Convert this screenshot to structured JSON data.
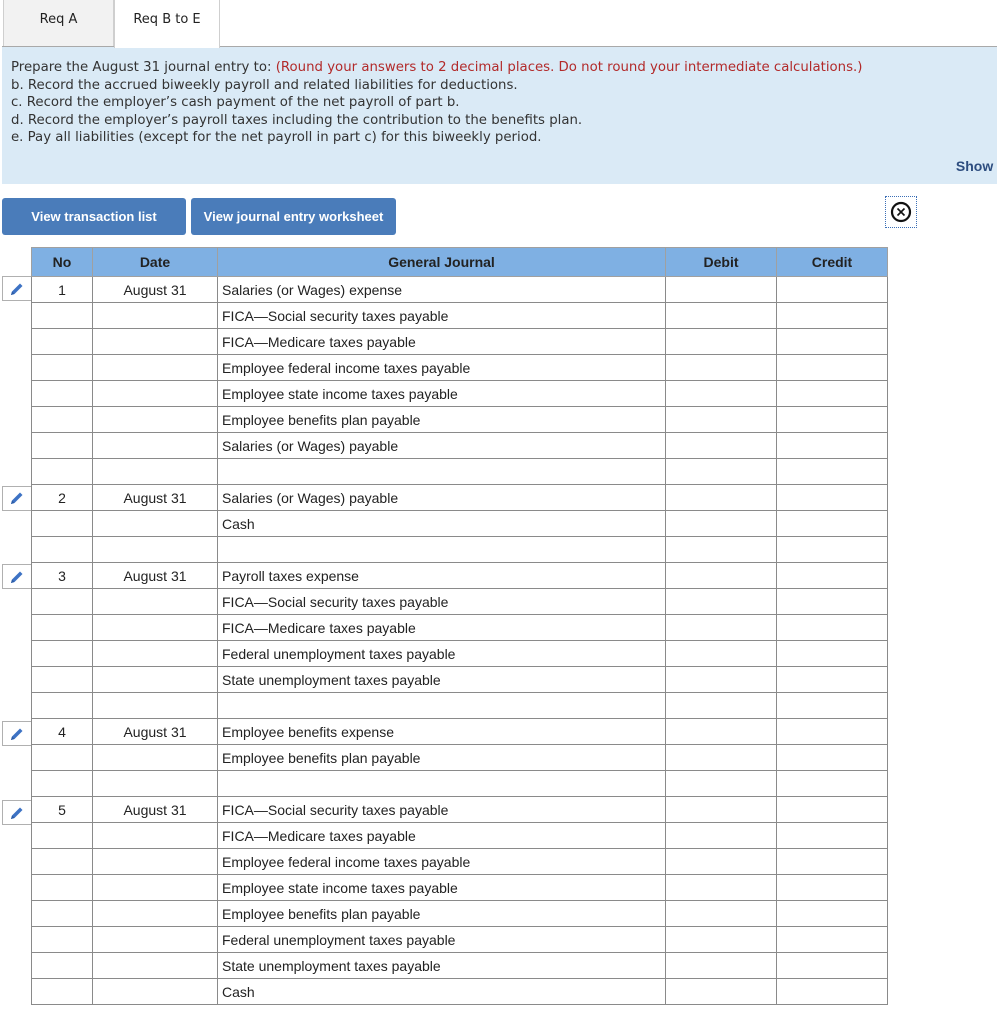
{
  "tabs": [
    {
      "label": "Req A",
      "active": false
    },
    {
      "label": "Req B to E",
      "active": true
    }
  ],
  "instructions": {
    "intro": "Prepare the August 31 journal entry to: ",
    "note": "(Round your answers to 2 decimal places. Do not round your intermediate calculations.)",
    "items": [
      "b. Record the accrued biweekly payroll and related liabilities for deductions.",
      "c. Record the employer’s cash payment of the net payroll of part b.",
      "d. Record the employer’s payroll taxes including the contribution to the benefits plan.",
      "e. Pay all liabilities (except for the net payroll in part c) for this biweekly period."
    ],
    "show_link": "Show l"
  },
  "buttons": {
    "view_transaction_list": "View transaction list",
    "view_journal_entry_worksheet": "View journal entry worksheet"
  },
  "icons": {
    "close": "circle-x-icon",
    "edit": "pencil-icon"
  },
  "colors": {
    "accent": "#4a7cba",
    "header": "#7fb0e3",
    "panel": "#daeaf6",
    "note": "#b22a2a"
  },
  "table": {
    "headers": {
      "no": "No",
      "date": "Date",
      "account": "General Journal",
      "debit": "Debit",
      "credit": "Credit"
    },
    "entries": [
      {
        "no": "1",
        "date": "August 31",
        "accounts": [
          "Salaries (or Wages) expense",
          "FICA—Social security taxes payable",
          "FICA—Medicare taxes payable",
          "Employee federal income taxes payable",
          "Employee state income taxes payable",
          "Employee benefits plan payable",
          "Salaries (or Wages) payable"
        ]
      },
      {
        "no": "2",
        "date": "August 31",
        "accounts": [
          "Salaries (or Wages) payable",
          "Cash"
        ]
      },
      {
        "no": "3",
        "date": "August 31",
        "accounts": [
          "Payroll taxes expense",
          "FICA—Social security taxes payable",
          "FICA—Medicare taxes payable",
          "Federal unemployment taxes payable",
          "State unemployment taxes payable"
        ]
      },
      {
        "no": "4",
        "date": "August 31",
        "accounts": [
          "Employee benefits expense",
          "Employee benefits plan payable"
        ]
      },
      {
        "no": "5",
        "date": "August 31",
        "accounts": [
          "FICA—Social security taxes payable",
          "FICA—Medicare taxes payable",
          "Employee federal income taxes payable",
          "Employee state income taxes payable",
          "Employee benefits plan payable",
          "Federal unemployment taxes payable",
          "State unemployment taxes payable",
          "Cash"
        ]
      }
    ]
  }
}
